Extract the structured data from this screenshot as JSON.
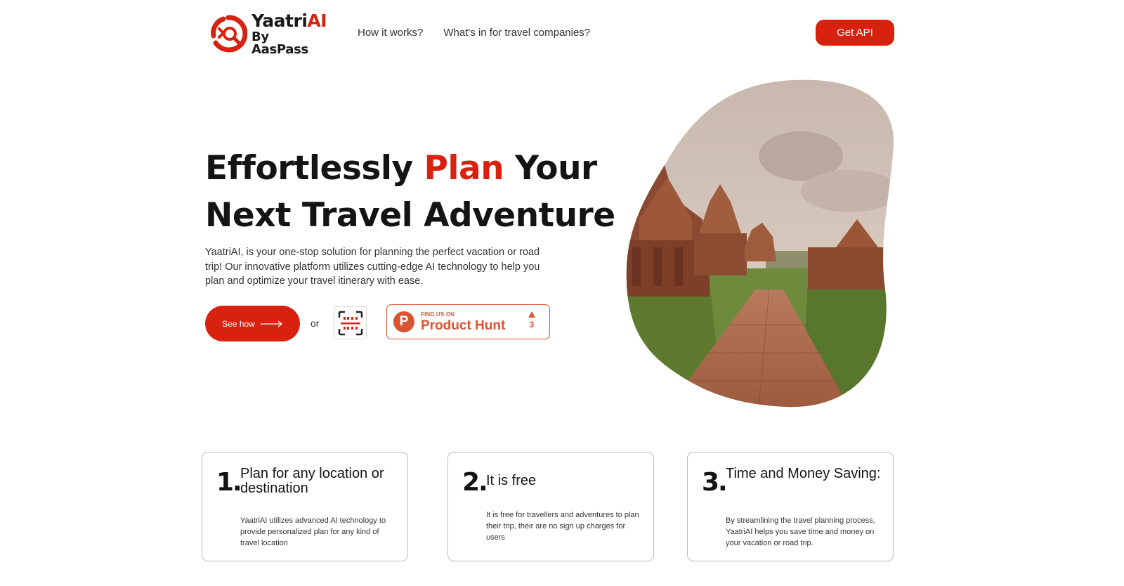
{
  "header": {
    "logo": {
      "name_main": "Yaatri",
      "name_accent": "AI",
      "byline": "By AasPass"
    },
    "nav": [
      {
        "label": "How it works?"
      },
      {
        "label": "What's in for travel companies?"
      }
    ],
    "api_button": "Get API"
  },
  "hero": {
    "headline": {
      "part1": "Effortlessly ",
      "accent": "Plan",
      "part2": " Your",
      "line2": "Next Travel Adventure"
    },
    "intro": "YaatriAI, is your one-stop solution for planning the perfect vacation or road trip! Our innovative platform utilizes cutting-edge AI technology to help you plan and optimize your travel itinerary with ease.",
    "see_how": "See how",
    "or": "or",
    "product_hunt": {
      "small": "FIND US ON",
      "name": "Product Hunt",
      "votes": "3",
      "logo_letter": "P"
    }
  },
  "features": [
    {
      "num": "1.",
      "title": "Plan for any location or destination",
      "desc": "YaatriAI utilizes advanced AI technology to provide personalized plan for any kind of travel location"
    },
    {
      "num": "2.",
      "title": "It is free",
      "desc": "It is free for travellers and adventures to plan their trip, their are no sign up charges for users"
    },
    {
      "num": "3.",
      "title": "Time and Money Saving:",
      "desc": "By streamlining the travel planning process, YaatriAI helps you save time and money on your vacation or road trip."
    }
  ],
  "colors": {
    "accent": "#d8220f",
    "product_hunt": "#da552f",
    "text": "#141414"
  },
  "icons": [
    "yaatriai-logo-icon",
    "arrow-right-icon",
    "qr-scan-icon",
    "product-hunt-icon",
    "upvote-arrow-icon"
  ]
}
